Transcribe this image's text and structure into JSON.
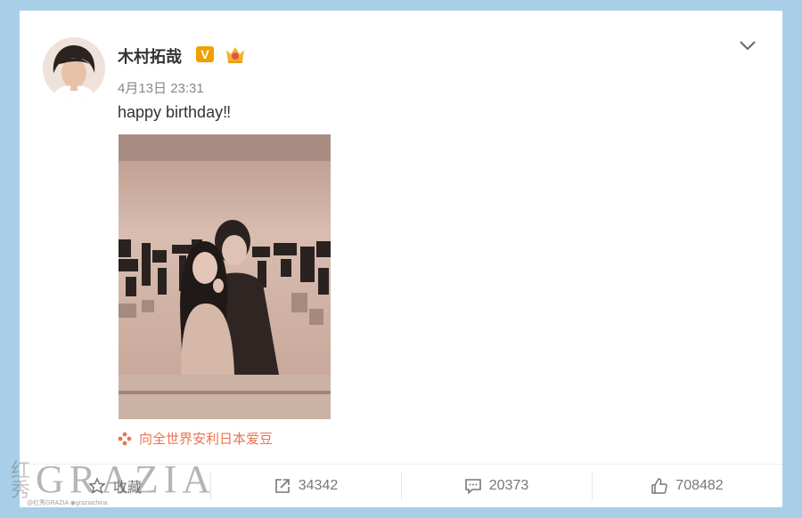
{
  "post": {
    "username": "木村拓哉",
    "verified_label": "V",
    "timestamp": "4月13日 23:31",
    "text": "happy birthday‼",
    "source_text": "向全世界安利日本爱豆"
  },
  "actions": {
    "favorite_label": "收藏",
    "repost_count": "34342",
    "comment_count": "20373",
    "like_count": "708482"
  },
  "watermark": {
    "latin": "GRAZIA",
    "chinese": "红秀",
    "small": "@红秀GRAZIA  ◉graziachina"
  },
  "colors": {
    "page_bg": "#a9cfe8",
    "accent": "#eb7350",
    "badge": "#f0a000"
  }
}
